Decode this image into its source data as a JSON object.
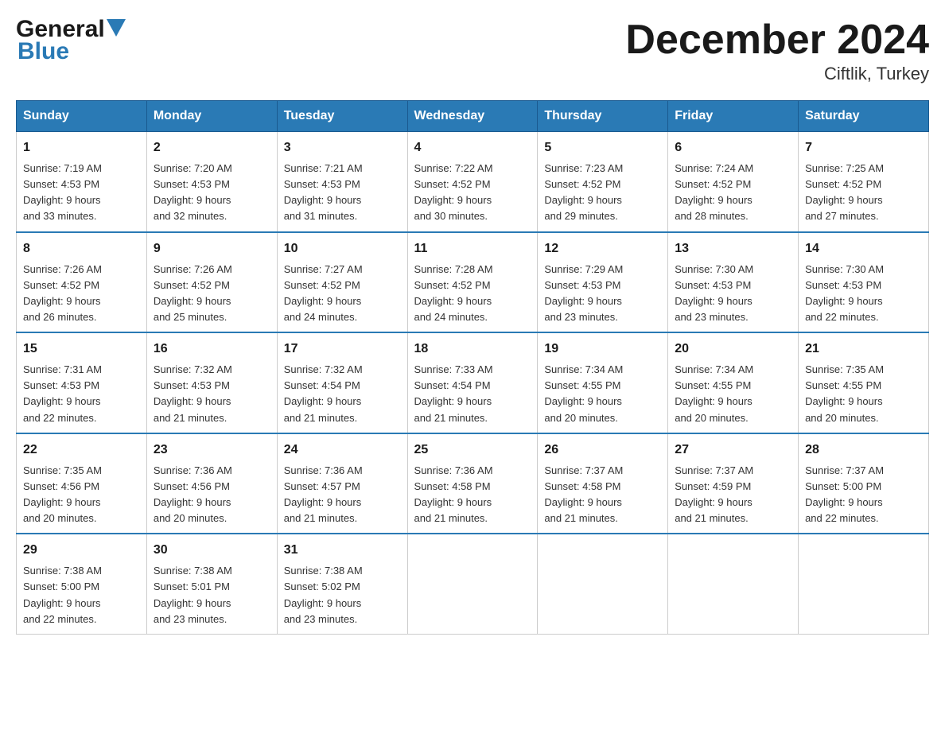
{
  "header": {
    "logo_general": "General",
    "logo_blue": "Blue",
    "month_title": "December 2024",
    "location": "Ciftlik, Turkey"
  },
  "days_of_week": [
    "Sunday",
    "Monday",
    "Tuesday",
    "Wednesday",
    "Thursday",
    "Friday",
    "Saturday"
  ],
  "weeks": [
    [
      {
        "day": "1",
        "sunrise": "7:19 AM",
        "sunset": "4:53 PM",
        "daylight": "9 hours and 33 minutes."
      },
      {
        "day": "2",
        "sunrise": "7:20 AM",
        "sunset": "4:53 PM",
        "daylight": "9 hours and 32 minutes."
      },
      {
        "day": "3",
        "sunrise": "7:21 AM",
        "sunset": "4:53 PM",
        "daylight": "9 hours and 31 minutes."
      },
      {
        "day": "4",
        "sunrise": "7:22 AM",
        "sunset": "4:52 PM",
        "daylight": "9 hours and 30 minutes."
      },
      {
        "day": "5",
        "sunrise": "7:23 AM",
        "sunset": "4:52 PM",
        "daylight": "9 hours and 29 minutes."
      },
      {
        "day": "6",
        "sunrise": "7:24 AM",
        "sunset": "4:52 PM",
        "daylight": "9 hours and 28 minutes."
      },
      {
        "day": "7",
        "sunrise": "7:25 AM",
        "sunset": "4:52 PM",
        "daylight": "9 hours and 27 minutes."
      }
    ],
    [
      {
        "day": "8",
        "sunrise": "7:26 AM",
        "sunset": "4:52 PM",
        "daylight": "9 hours and 26 minutes."
      },
      {
        "day": "9",
        "sunrise": "7:26 AM",
        "sunset": "4:52 PM",
        "daylight": "9 hours and 25 minutes."
      },
      {
        "day": "10",
        "sunrise": "7:27 AM",
        "sunset": "4:52 PM",
        "daylight": "9 hours and 24 minutes."
      },
      {
        "day": "11",
        "sunrise": "7:28 AM",
        "sunset": "4:52 PM",
        "daylight": "9 hours and 24 minutes."
      },
      {
        "day": "12",
        "sunrise": "7:29 AM",
        "sunset": "4:53 PM",
        "daylight": "9 hours and 23 minutes."
      },
      {
        "day": "13",
        "sunrise": "7:30 AM",
        "sunset": "4:53 PM",
        "daylight": "9 hours and 23 minutes."
      },
      {
        "day": "14",
        "sunrise": "7:30 AM",
        "sunset": "4:53 PM",
        "daylight": "9 hours and 22 minutes."
      }
    ],
    [
      {
        "day": "15",
        "sunrise": "7:31 AM",
        "sunset": "4:53 PM",
        "daylight": "9 hours and 22 minutes."
      },
      {
        "day": "16",
        "sunrise": "7:32 AM",
        "sunset": "4:53 PM",
        "daylight": "9 hours and 21 minutes."
      },
      {
        "day": "17",
        "sunrise": "7:32 AM",
        "sunset": "4:54 PM",
        "daylight": "9 hours and 21 minutes."
      },
      {
        "day": "18",
        "sunrise": "7:33 AM",
        "sunset": "4:54 PM",
        "daylight": "9 hours and 21 minutes."
      },
      {
        "day": "19",
        "sunrise": "7:34 AM",
        "sunset": "4:55 PM",
        "daylight": "9 hours and 20 minutes."
      },
      {
        "day": "20",
        "sunrise": "7:34 AM",
        "sunset": "4:55 PM",
        "daylight": "9 hours and 20 minutes."
      },
      {
        "day": "21",
        "sunrise": "7:35 AM",
        "sunset": "4:55 PM",
        "daylight": "9 hours and 20 minutes."
      }
    ],
    [
      {
        "day": "22",
        "sunrise": "7:35 AM",
        "sunset": "4:56 PM",
        "daylight": "9 hours and 20 minutes."
      },
      {
        "day": "23",
        "sunrise": "7:36 AM",
        "sunset": "4:56 PM",
        "daylight": "9 hours and 20 minutes."
      },
      {
        "day": "24",
        "sunrise": "7:36 AM",
        "sunset": "4:57 PM",
        "daylight": "9 hours and 21 minutes."
      },
      {
        "day": "25",
        "sunrise": "7:36 AM",
        "sunset": "4:58 PM",
        "daylight": "9 hours and 21 minutes."
      },
      {
        "day": "26",
        "sunrise": "7:37 AM",
        "sunset": "4:58 PM",
        "daylight": "9 hours and 21 minutes."
      },
      {
        "day": "27",
        "sunrise": "7:37 AM",
        "sunset": "4:59 PM",
        "daylight": "9 hours and 21 minutes."
      },
      {
        "day": "28",
        "sunrise": "7:37 AM",
        "sunset": "5:00 PM",
        "daylight": "9 hours and 22 minutes."
      }
    ],
    [
      {
        "day": "29",
        "sunrise": "7:38 AM",
        "sunset": "5:00 PM",
        "daylight": "9 hours and 22 minutes."
      },
      {
        "day": "30",
        "sunrise": "7:38 AM",
        "sunset": "5:01 PM",
        "daylight": "9 hours and 23 minutes."
      },
      {
        "day": "31",
        "sunrise": "7:38 AM",
        "sunset": "5:02 PM",
        "daylight": "9 hours and 23 minutes."
      },
      null,
      null,
      null,
      null
    ]
  ],
  "labels": {
    "sunrise": "Sunrise:",
    "sunset": "Sunset:",
    "daylight": "Daylight:"
  }
}
